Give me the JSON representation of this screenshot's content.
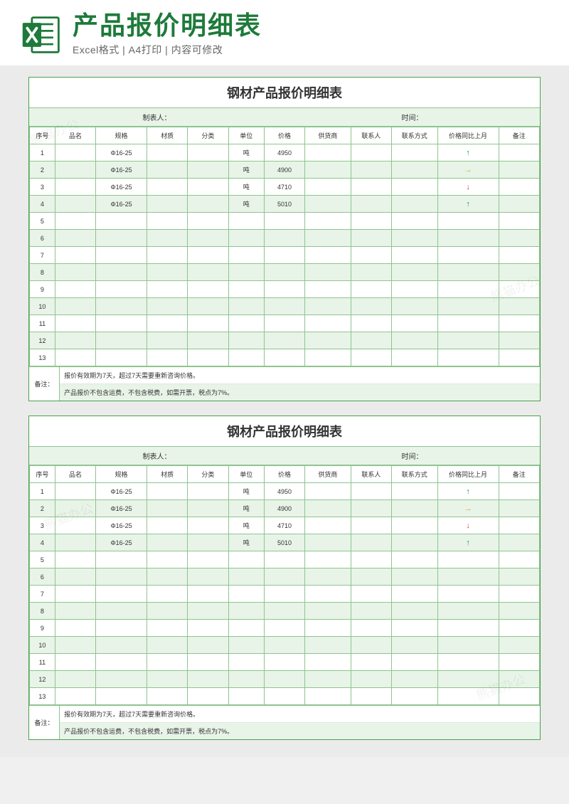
{
  "header": {
    "title": "产品报价明细表",
    "sub_excel": "Excel格式",
    "sep": " | ",
    "sub_print": "A4打印",
    "sub_edit": "内容可修改"
  },
  "sheet": {
    "title": "钢材产品报价明细表",
    "meta_maker_label": "制表人：",
    "meta_time_label": "时间：",
    "columns": {
      "seq": "序号",
      "name": "品名",
      "spec": "规格",
      "mat": "材质",
      "cat": "分类",
      "unit": "单位",
      "price": "价格",
      "supp": "供货商",
      "contact": "联系人",
      "phone": "联系方式",
      "trend": "价格同比上月",
      "note": "备注"
    },
    "rows": [
      {
        "seq": "1",
        "name": "",
        "spec": "Φ16-25",
        "mat": "",
        "cat": "",
        "unit": "吨",
        "price": "4950",
        "supp": "",
        "contact": "",
        "phone": "",
        "trend": "up",
        "note": ""
      },
      {
        "seq": "2",
        "name": "",
        "spec": "Φ16-25",
        "mat": "",
        "cat": "",
        "unit": "吨",
        "price": "4900",
        "supp": "",
        "contact": "",
        "phone": "",
        "trend": "flat",
        "note": ""
      },
      {
        "seq": "3",
        "name": "",
        "spec": "Φ16-25",
        "mat": "",
        "cat": "",
        "unit": "吨",
        "price": "4710",
        "supp": "",
        "contact": "",
        "phone": "",
        "trend": "down",
        "note": ""
      },
      {
        "seq": "4",
        "name": "",
        "spec": "Φ16-25",
        "mat": "",
        "cat": "",
        "unit": "吨",
        "price": "5010",
        "supp": "",
        "contact": "",
        "phone": "",
        "trend": "up",
        "note": ""
      },
      {
        "seq": "5"
      },
      {
        "seq": "6"
      },
      {
        "seq": "7"
      },
      {
        "seq": "8"
      },
      {
        "seq": "9"
      },
      {
        "seq": "10"
      },
      {
        "seq": "11"
      },
      {
        "seq": "12"
      },
      {
        "seq": "13"
      }
    ],
    "notes_label": "备注：",
    "notes": [
      "报价有效期为7天，超过7天需要重新咨询价格。",
      "产品报价不包含运费，不包含税费，如需开票，税点为7%。"
    ]
  },
  "trend_glyphs": {
    "up": "↑",
    "flat": "→",
    "down": "↓"
  },
  "watermark_text": "熊猫办公"
}
